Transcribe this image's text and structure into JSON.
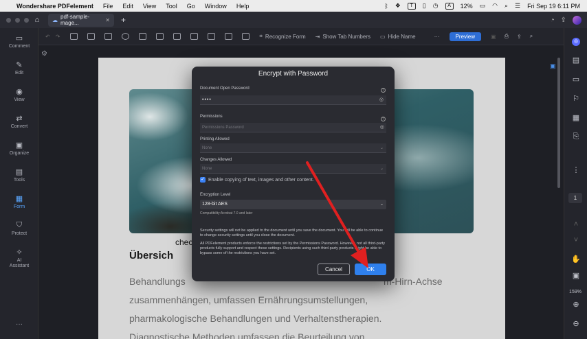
{
  "menubar": {
    "app_name": "Wondershare PDFelement",
    "menus": [
      "File",
      "Edit",
      "View",
      "Tool",
      "Go",
      "Window",
      "Help"
    ],
    "battery": "12%",
    "datetime": "Fri Sep 19  6:11 PM"
  },
  "titlebar": {
    "tab_label": "pdf-sample-mage..."
  },
  "left_sidebar": {
    "items": [
      "Comment",
      "Edit",
      "View",
      "Convert",
      "Organize",
      "Tools",
      "Form",
      "Protect",
      "AI Assistant"
    ]
  },
  "toolbar": {
    "recognize_form": "Recognize Form",
    "show_tab_numbers": "Show Tab Numbers",
    "hide_name": "Hide Name",
    "preview": "Preview"
  },
  "page": {
    "caption": "chec",
    "heading": "Übersich",
    "lines": [
      "Behandlungs",
      "zusammenhängen, umfassen Ernährungsumstellungen,",
      "pharmakologische Behandlungen und Verhaltenstherapien.",
      "Diagnostische Methoden umfassen die Beurteilung von"
    ],
    "line1_right": "m-Hirn-Achse"
  },
  "right_panel": {
    "page_number": "1",
    "zoom": "159%"
  },
  "dialog": {
    "title": "Encrypt with Password",
    "open_password_label": "Document Open Password",
    "open_password_value": "••••",
    "permissions_label": "Permissions",
    "permissions_placeholder": "Permissions Password",
    "printing_label": "Printing Allowed",
    "printing_value": "None",
    "changes_label": "Changes Allowed",
    "changes_value": "None",
    "copy_label": "Enable copying of text, images and other content.",
    "encryption_label": "Encryption Level",
    "encryption_value": "128-bit AES",
    "compatibility": "Compatibility:Acrobat 7.0 and later",
    "note1": "Security settings will not be applied to the document until you save the document. You will be able to continue to change security settings until you close the document.",
    "note2": "All PDFelement products enforce the restrictions set by the Permissions Password. However, not all third-party products fully support and respect these settings. Recipients using such third-party products might be able to bypass some of the restrictions you have set.",
    "cancel": "Cancel",
    "ok": "OK"
  },
  "colors": {
    "accent": "#2f80ed",
    "annotation_arrow": "#e02020"
  }
}
